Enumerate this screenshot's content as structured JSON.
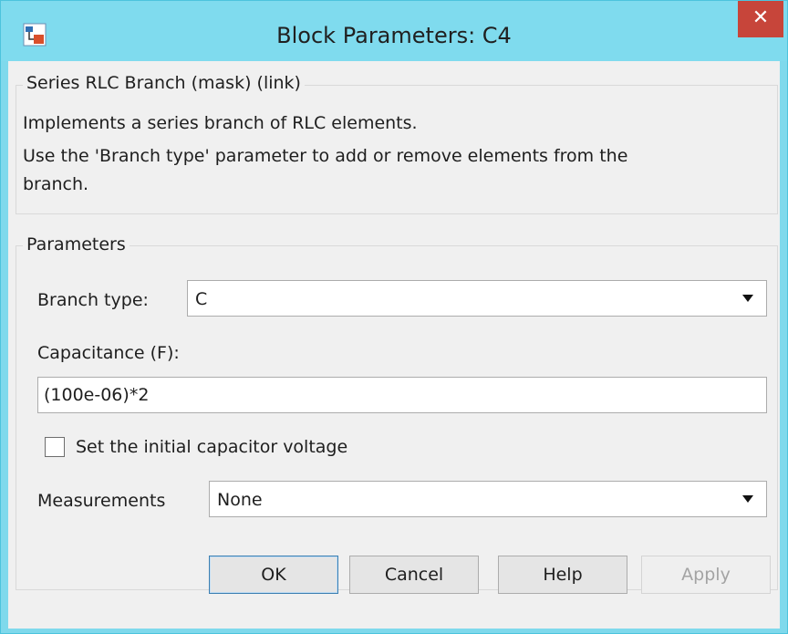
{
  "window": {
    "title": "Block Parameters: C4",
    "close_glyph": "✕"
  },
  "mask_group": {
    "legend": "Series RLC Branch (mask) (link)",
    "description_line1": "Implements a series branch of RLC elements.",
    "description_line2": "Use the 'Branch type' parameter to add or remove elements from the",
    "description_line3": "branch."
  },
  "parameters": {
    "legend": "Parameters",
    "branch_type_label": "Branch type:",
    "branch_type_value": "C",
    "capacitance_label": "Capacitance (F):",
    "capacitance_value": "(100e-06)*2",
    "initial_voltage_label": "Set the initial capacitor voltage",
    "initial_voltage_checked": false,
    "measurements_label": "Measurements",
    "measurements_value": "None"
  },
  "buttons": {
    "ok": "OK",
    "cancel": "Cancel",
    "help": "Help",
    "apply": "Apply"
  },
  "icons": {
    "app": "simulink-block-icon",
    "close": "close-icon",
    "dropdown": "chevron-down-icon"
  },
  "colors": {
    "titlebar": "#7fdbee",
    "close": "#c7453a",
    "client": "#f0f0f0"
  }
}
